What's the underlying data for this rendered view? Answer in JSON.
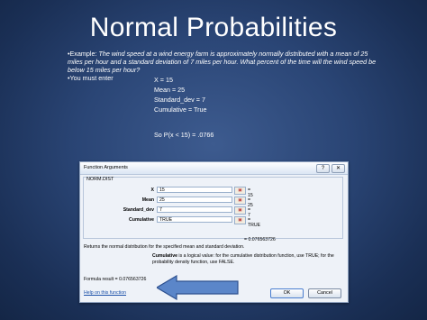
{
  "slide": {
    "title": "Normal Probabilities",
    "bullet1_prefix": "•Example: ",
    "bullet1_text": "The wind speed at a wind energy farm is approximately normally distributed with a mean of 25 miles per hour and a standard deviation of 7 miles per hour. What percent of the time will the wind speed be below 15 miles per hour?",
    "bullet2": "•You must enter",
    "enter_lines": [
      "X =  15",
      "Mean = 25",
      "Standard_dev = 7",
      "Cumulative = True"
    ],
    "result": "So  P(x < 15) = .0766"
  },
  "dialog": {
    "title": "Function Arguments",
    "help_btn": "?",
    "close_btn": "✕",
    "function_name": "NORM.DIST",
    "args": [
      {
        "label": "X",
        "input": "15",
        "value": "= 15"
      },
      {
        "label": "Mean",
        "input": "25",
        "value": "= 25"
      },
      {
        "label": "Standard_dev",
        "input": "7",
        "value": "= 7"
      },
      {
        "label": "Cumulative",
        "input": "TRUE",
        "value": "= TRUE"
      }
    ],
    "function_result": "= 0.076563726",
    "description": "Returns the normal distribution for the specified mean and standard deviation.",
    "arg_desc_label": "Cumulative",
    "arg_desc_text": " is a logical value: for the cumulative distribution function, use TRUE; for the probability density function, use FALSE.",
    "formula_result": "Formula result =  0.076563726",
    "help_link": "Help on this function",
    "ok_label": "OK",
    "cancel_label": "Cancel"
  },
  "colors": {
    "arrow": "#5b86c9",
    "background": "#2a4575"
  }
}
